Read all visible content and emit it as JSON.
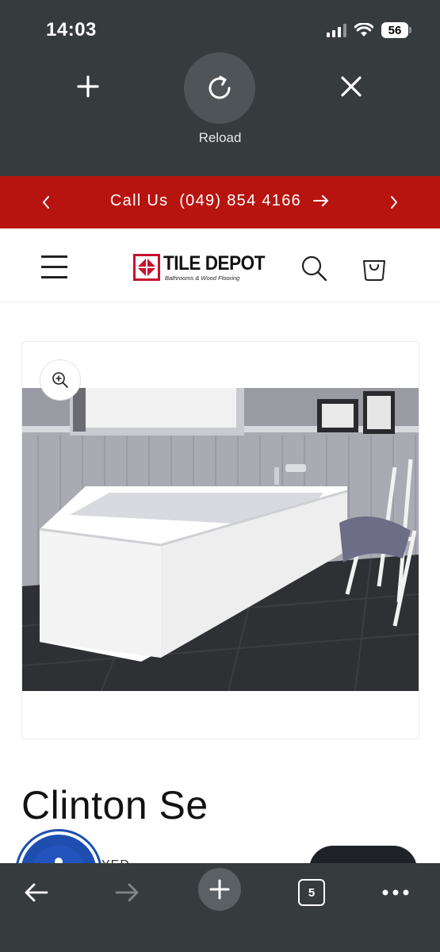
{
  "status_bar": {
    "time": "14:03",
    "battery": "56"
  },
  "browser_overlay": {
    "reload_label": "Reload"
  },
  "announcement": {
    "text": "Call Us  (049) 854 4166"
  },
  "logo": {
    "title": "TILE DEPOT",
    "subtitle": "Bathrooms & Wood Flooring"
  },
  "product": {
    "title": "Clinton Se",
    "peek_text": "YED"
  },
  "toolbar": {
    "tab_count": "5"
  },
  "colors": {
    "chrome": "#363b3e",
    "announcement_bg": "#b8140f",
    "brand_red": "#c8102e",
    "accessibility_blue": "#1e4fb0"
  },
  "icons": [
    "plus-icon",
    "reload-icon",
    "close-icon",
    "chevron-left-icon",
    "chevron-right-icon",
    "arrow-right-icon",
    "hamburger-icon",
    "search-icon",
    "cart-icon",
    "zoom-in-icon",
    "accessibility-icon",
    "back-icon",
    "forward-icon",
    "new-tab-icon",
    "tabs-icon",
    "more-icon"
  ]
}
